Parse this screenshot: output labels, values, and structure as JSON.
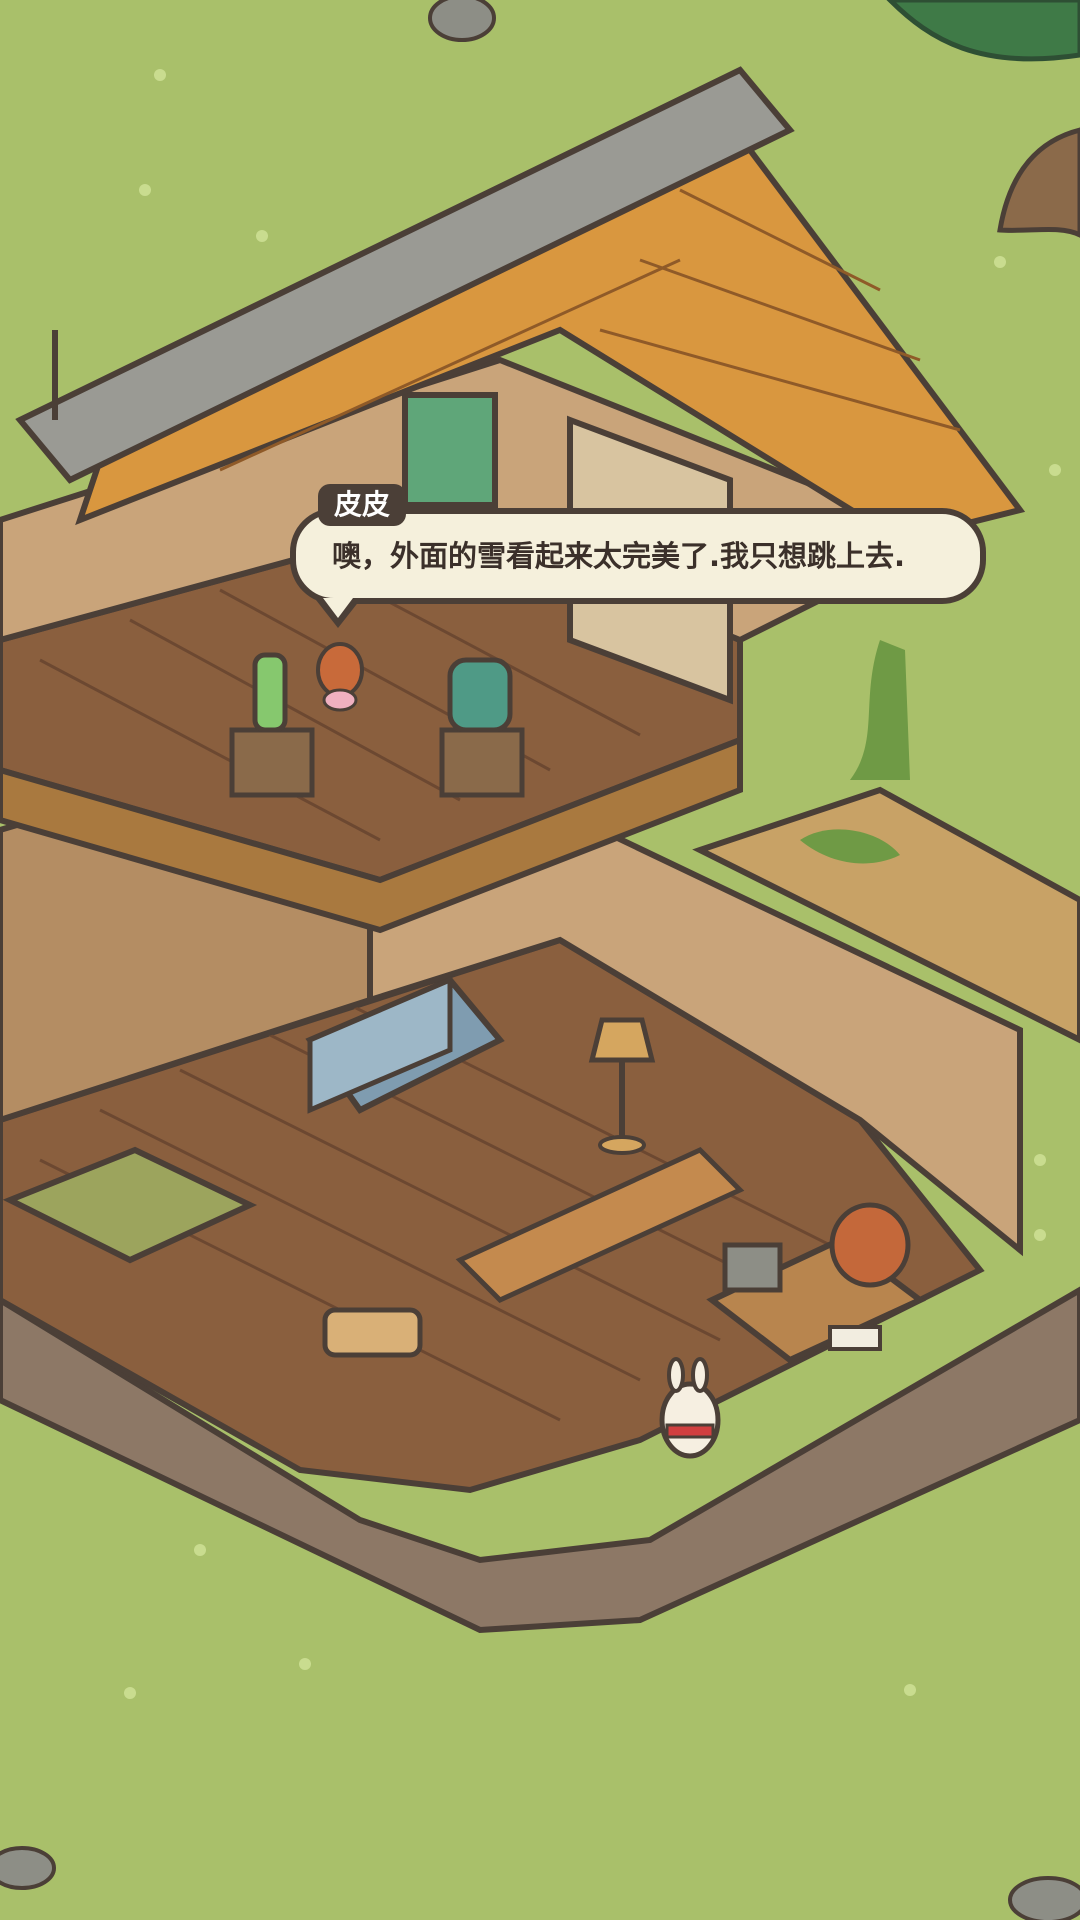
{
  "dialogue": {
    "speaker": "皮皮",
    "text": "噢，外面的雪看起来太完美了.我只想跳上去."
  },
  "colors": {
    "grass": "#a9c06a",
    "floor_wood": "#8a5f3e",
    "wall": "#c9a47a",
    "roof_tile": "#d9973f",
    "bubble_fill": "#f5f0dc",
    "bubble_border": "#4b3f37"
  },
  "scene": {
    "objects": [
      "oak-tree",
      "house-roof",
      "upper-floor",
      "ramune-bottle-on-pedestal",
      "backpack-on-pedestal",
      "fox-character",
      "sofa",
      "floor-lamp",
      "rug",
      "footstool",
      "desk-with-cash-register",
      "red-panda-shopkeeper",
      "open-book",
      "rabbit-player-character",
      "stairs",
      "rocks"
    ]
  }
}
